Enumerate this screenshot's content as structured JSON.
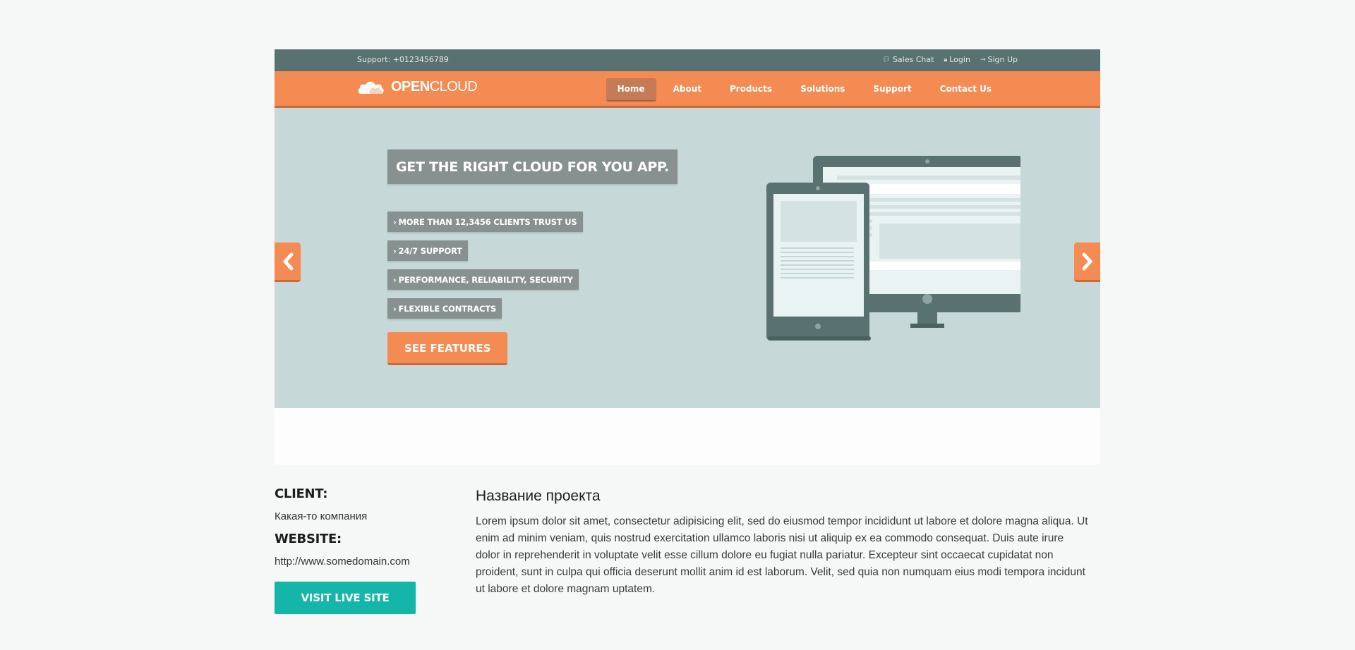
{
  "topbar": {
    "support": "Support: +0123456789",
    "links": [
      "Sales Chat",
      "Login",
      "Sign Up"
    ]
  },
  "logo": {
    "bold": "OPEN",
    "light": "CLOUD"
  },
  "nav": [
    "Home",
    "About",
    "Products",
    "Solutions",
    "Support",
    "Contact Us"
  ],
  "hero": {
    "headline": "GET THE RIGHT CLOUD FOR YOU APP.",
    "features": [
      "MORE THAN 12,3456 CLIENTS TRUST US",
      "24/7 SUPPORT",
      "PERFORMANCE, RELIABILITY, SECURITY",
      "FLEXIBLE CONTRACTS"
    ],
    "cta": "SEE FEATURES"
  },
  "project": {
    "client_label": "CLIENT:",
    "client_value": "Какая-то компания",
    "website_label": "WEBSITE:",
    "website_value": "http://www.somedomain.com",
    "visit_button": "VISIT LIVE SITE",
    "title": "Название проекта",
    "description": "Lorem ipsum dolor sit amet, consectetur adipisicing elit, sed do eiusmod tempor incididunt ut labore et dolore magna aliqua. Ut enim ad minim veniam, quis nostrud exercitation ullamco laboris nisi ut aliquip ex ea commodo consequat. Duis aute irure dolor in reprehenderit in voluptate velit esse cillum dolore eu fugiat nulla pariatur. Excepteur sint occaecat cupidatat non proident, sunt in culpa qui officia deserunt mollit anim id est laborum. Velit, sed quia non numquam eius modi tempora incidunt ut labore et dolore magnam uptatem."
  },
  "colors": {
    "orange": "#f48b53",
    "teal_dark": "#5a7171",
    "hero_bg": "#c6d8d7",
    "visit": "#13b6a8"
  }
}
